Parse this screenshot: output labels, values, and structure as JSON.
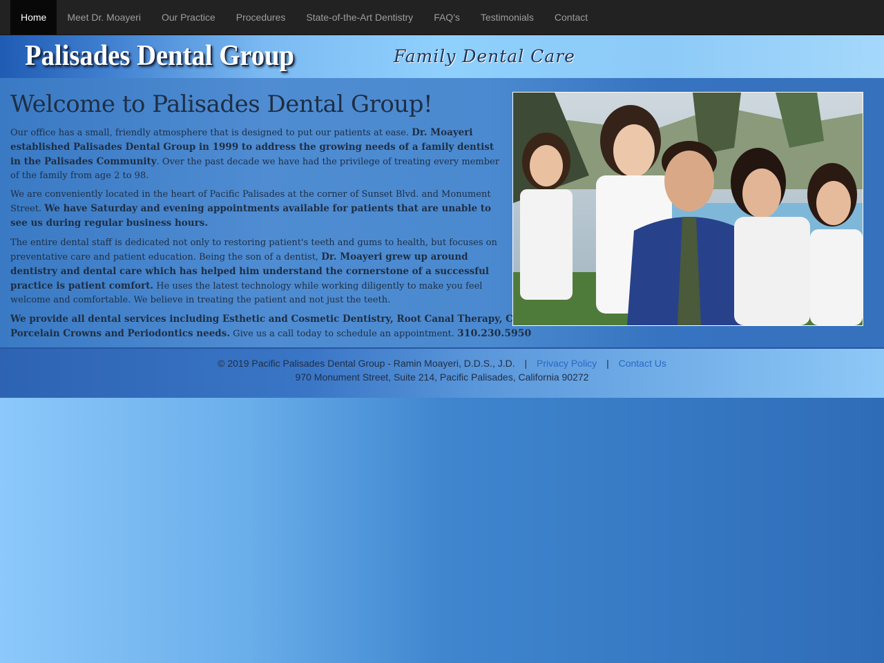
{
  "nav": {
    "items": [
      {
        "label": "Home",
        "active": true
      },
      {
        "label": "Meet Dr. Moayeri"
      },
      {
        "label": "Our Practice"
      },
      {
        "label": "Procedures"
      },
      {
        "label": "State-of-the-Art Dentistry"
      },
      {
        "label": "FAQ's"
      },
      {
        "label": "Testimonials"
      },
      {
        "label": "Contact"
      }
    ]
  },
  "banner": {
    "logo": "Palisades Dental Group",
    "tagline": "Family Dental Care"
  },
  "main": {
    "heading": "Welcome to Palisades Dental Group!",
    "p1": {
      "a": "Our office has a small, friendly atmosphere that is designed to put our patients at ease. ",
      "b": "Dr. Moayeri established Palisades Dental Group in 1999 to address the growing needs of a family dentist in the Palisades Community",
      "c": ". Over the past decade we have had the privilege of treating every member of the family from age 2 to 98."
    },
    "p2": {
      "a": "We are conveniently located in the heart of Pacific Palisades at the corner of Sunset Blvd. and Monument Street. ",
      "b": "We have Saturday and evening appointments available for patients that are unable to see us during regular business hours."
    },
    "p3": {
      "a": "The entire dental staff is dedicated not only to restoring patient's teeth and gums to health, but focuses on preventative care and patient education. Being the son of a dentist, ",
      "b": "Dr. Moayeri grew up around dentistry and dental care which has helped him understand the cornerstone of a successful practice is patient comfort.",
      "c": " He uses the latest technology while working diligently to make you feel welcome and comfortable. We believe in treating the patient and not just the teeth."
    },
    "p4": {
      "b": "We provide all dental services including Esthetic and Cosmetic Dentistry, Root Canal Therapy, Crown and Bridge, Dental veneers, Teeth Whitening, Pediatric, Porcelain Crowns and Periodontics needs.",
      "c": " Give us a call today to schedule an appointment. ",
      "phone": "310.230.5950"
    }
  },
  "footer": {
    "copyright": "© 2019  Pacific Palisades Dental Group - Ramin Moayeri, D.D.S., J.D.",
    "separator": "|",
    "privacy": "Privacy Policy",
    "contact": "Contact Us",
    "address": "970 Monument Street, Suite 214, Pacific Palisades, California 90272"
  },
  "colors": {
    "nav_bg": "#222222",
    "nav_text": "#9d9d9d",
    "nav_active_bg": "#080808",
    "body_text": "#1e2e44",
    "link": "#2a68c4"
  }
}
